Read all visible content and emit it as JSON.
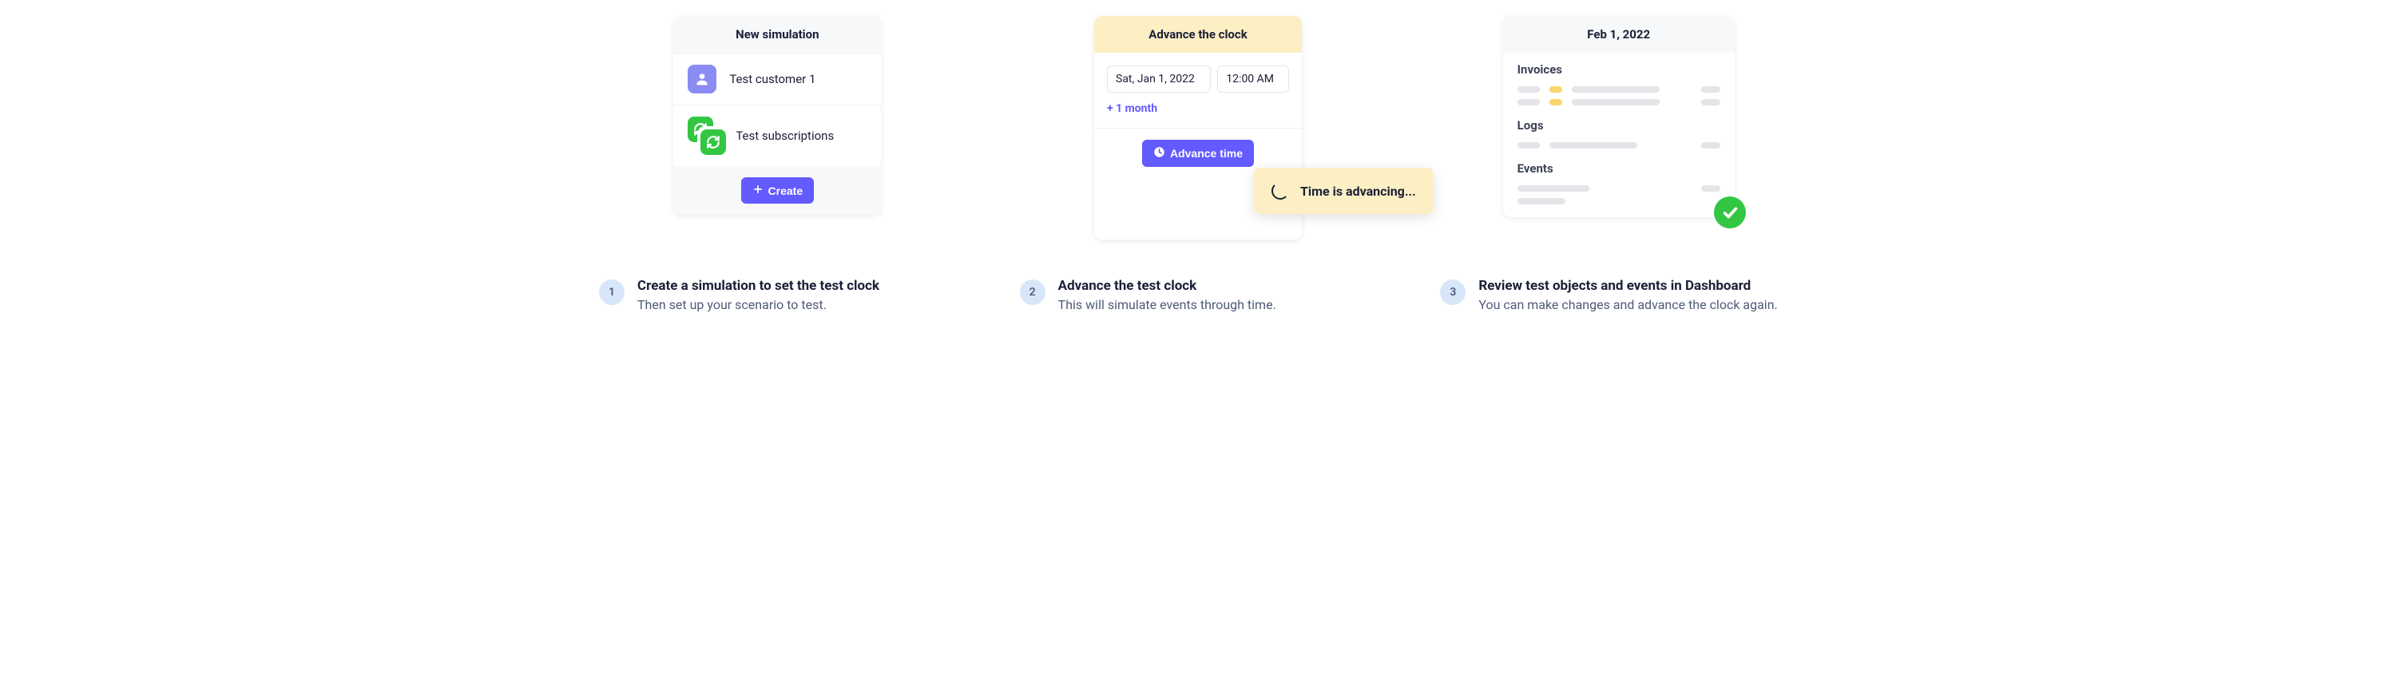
{
  "col1": {
    "card_title": "New simulation",
    "customer_label": "Test customer 1",
    "subscriptions_label": "Test subscriptions",
    "create_button": "Create",
    "step_number": "1",
    "step_title": "Create a simulation to set the test clock",
    "step_subtitle": "Then set up your scenario to test."
  },
  "col2": {
    "card_title": "Advance the clock",
    "date_value": "Sat, Jan 1, 2022",
    "time_value": "12:00 AM",
    "interval_link": "+ 1 month",
    "advance_button": "Advance time",
    "toast_text": "Time is advancing...",
    "step_number": "2",
    "step_title": "Advance the test clock",
    "step_subtitle": "This will simulate events through time."
  },
  "col3": {
    "card_title": "Feb 1, 2022",
    "section_invoices": "Invoices",
    "section_logs": "Logs",
    "section_events": "Events",
    "step_number": "3",
    "step_title": "Review test objects and events in Dashboard",
    "step_subtitle": "You can make changes and advance the clock again."
  }
}
